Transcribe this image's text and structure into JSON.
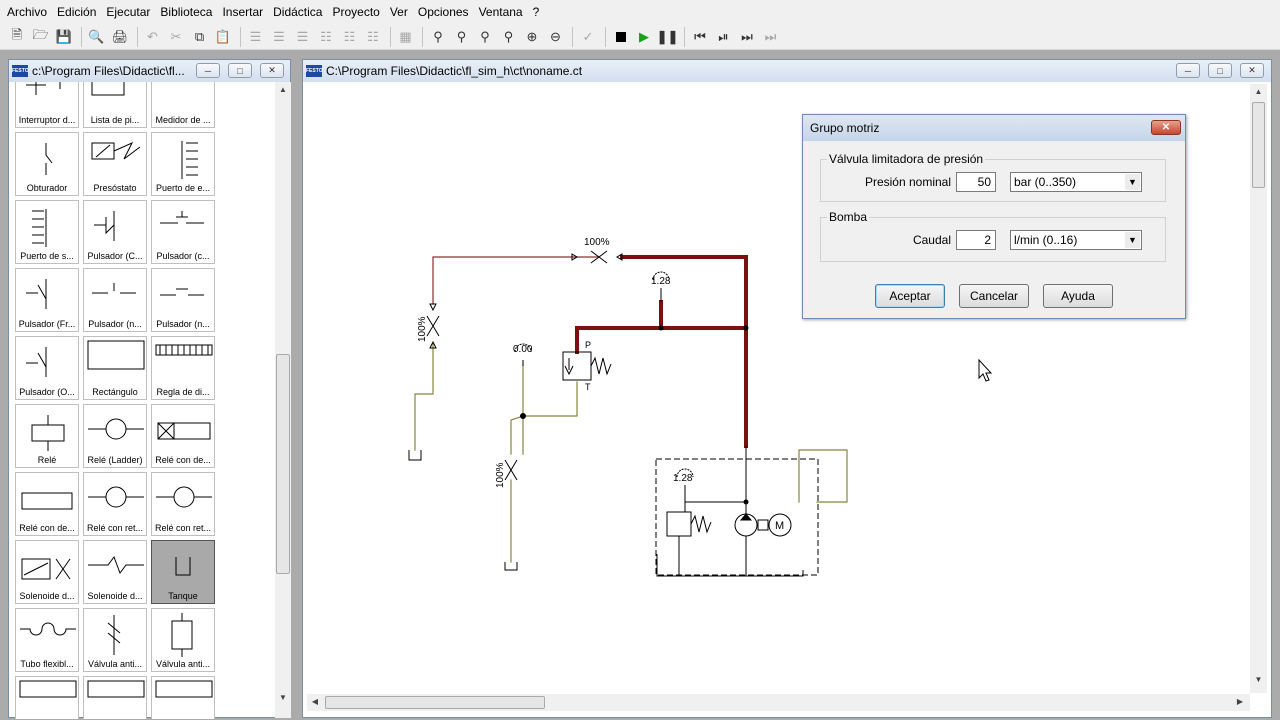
{
  "menu": [
    "Archivo",
    "Edición",
    "Ejecutar",
    "Biblioteca",
    "Insertar",
    "Didáctica",
    "Proyecto",
    "Ver",
    "Opciones",
    "Ventana",
    "?"
  ],
  "toolbar_icons": [
    "new-file-icon",
    "open-file-icon",
    "save-icon",
    "print-preview-icon",
    "print-icon",
    "undo-icon",
    "cut-icon",
    "copy-icon",
    "paste-icon",
    "align-left-icon",
    "align-center-icon",
    "align-right-icon",
    "align-top-icon",
    "align-middle-icon",
    "align-bottom-icon",
    "grid-icon",
    "zoom-fit-icon",
    "zoom-window-icon",
    "zoom-all-icon",
    "zoom-page-icon",
    "zoom-in-icon",
    "zoom-out-icon",
    "check-circuit-icon",
    "stop-icon",
    "play-icon",
    "pause-icon",
    "rewind-icon",
    "step-icon",
    "forward-icon",
    "fast-forward-icon"
  ],
  "library": {
    "title": "c:\\Program Files\\Didactic\\fl...",
    "items": [
      "Interruptor d...",
      "Lista de pi...",
      "Medidor de ...",
      "Obturador",
      "Presóstato",
      "Puerto de e...",
      "Puerto de s...",
      "Pulsador (C...",
      "Pulsador (c...",
      "Pulsador (Fr...",
      "Pulsador (n...",
      "Pulsador (n...",
      "Pulsador (O...",
      "Rectángulo",
      "Regla de di...",
      "Relé",
      "Relé (Ladder)",
      "Relé con de...",
      "Relé con de...",
      "Relé con ret...",
      "Relé con ret...",
      "Solenoide d...",
      "Solenoide d...",
      "Tanque",
      "Tubo flexibl...",
      "Válvula anti...",
      "Válvula anti...",
      "",
      "",
      ""
    ],
    "selected": "Tanque"
  },
  "circuit_window": {
    "title": "C:\\Program Files\\Didactic\\fl_sim_h\\ct\\noname.ct",
    "labels": {
      "throttle_top": "100%",
      "throttle_left": "100%",
      "throttle_bottom": "100%",
      "gauge_top": "1.28",
      "gauge_left": "0.00",
      "gauge_unit": "1.28",
      "port_p": "P",
      "port_t": "T",
      "motor": "M"
    },
    "line_colors": {
      "pressurized": "#7a1010",
      "return": "#8a8540",
      "signal": "#7a3a3a"
    }
  },
  "dialog": {
    "title": "Grupo motriz",
    "valve_group": "Válvula limitadora de presión",
    "pressure_label": "Presión nominal",
    "pressure_value": "50",
    "pressure_unit": "bar  (0..350)",
    "pump_group": "Bomba",
    "flow_label": "Caudal",
    "flow_value": "2",
    "flow_unit": "l/min  (0..16)",
    "ok": "Aceptar",
    "cancel": "Cancelar",
    "help": "Ayuda"
  }
}
